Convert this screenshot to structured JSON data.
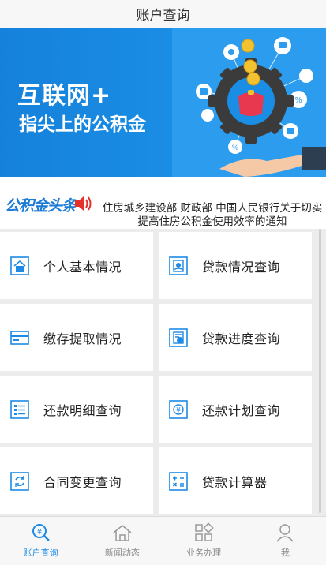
{
  "header": {
    "title": "账户查询"
  },
  "banner": {
    "line1": "互联网+",
    "line2": "指尖上的公积金"
  },
  "news": {
    "logo": "公积金头条",
    "headline": "住房城乡建设部 财政部 中国人民银行关于切实提高住房公积金使用效率的通知"
  },
  "menu": [
    {
      "label": "个人基本情况",
      "icon": "house-icon"
    },
    {
      "label": "贷款情况查询",
      "icon": "loan-status-icon"
    },
    {
      "label": "缴存提取情况",
      "icon": "card-icon"
    },
    {
      "label": "贷款进度查询",
      "icon": "progress-icon"
    },
    {
      "label": "还款明细查询",
      "icon": "list-icon"
    },
    {
      "label": "还款计划查询",
      "icon": "yen-plan-icon"
    },
    {
      "label": "合同变更查询",
      "icon": "refresh-icon"
    },
    {
      "label": "贷款计算器",
      "icon": "calculator-icon"
    }
  ],
  "tabs": [
    {
      "label": "账户查询",
      "icon": "yen-search-icon",
      "active": true
    },
    {
      "label": "新闻动态",
      "icon": "home-icon",
      "active": false
    },
    {
      "label": "业务办理",
      "icon": "grid-icon",
      "active": false
    },
    {
      "label": "我",
      "icon": "person-icon",
      "active": false
    }
  ],
  "colors": {
    "accent": "#1d8ae6",
    "banner": "#1a8de4",
    "news_logo": "#1d7cd6",
    "speaker": "#e8302a"
  }
}
